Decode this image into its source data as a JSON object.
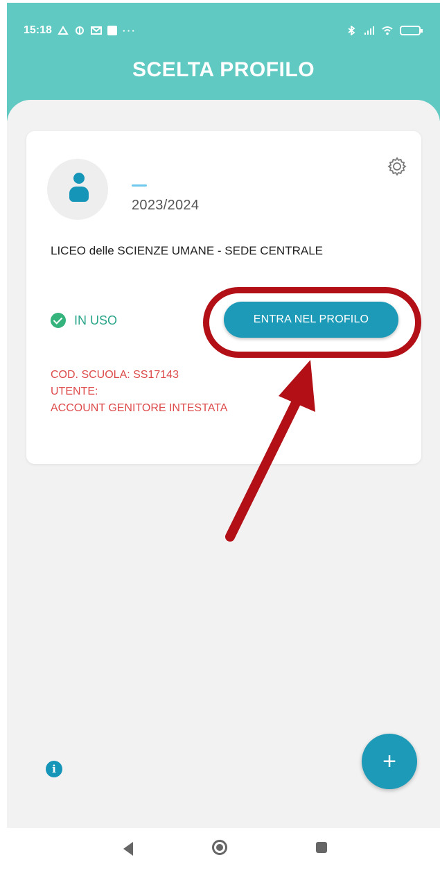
{
  "status_bar": {
    "time": "15:18",
    "dots": "···"
  },
  "header": {
    "title": "SCELTA PROFILO"
  },
  "profile_card": {
    "year": "2023/2024",
    "school": "LICEO delle SCIENZE UMANE - SEDE CENTRALE",
    "status": "IN USO",
    "enter_button": "ENTRA NEL PROFILO",
    "school_code": "COD. SCUOLA: SS17143",
    "user_label": "UTENTE:",
    "account": "ACCOUNT GENITORE INTESTATA"
  },
  "fab": {
    "label": "+"
  },
  "info_button": {
    "label": "i"
  },
  "colors": {
    "header": "#5fc9c2",
    "primary": "#1c9ab7",
    "highlight": "#b21016",
    "warning_text": "#dd4a4a",
    "status_ok": "#2aa58a"
  }
}
